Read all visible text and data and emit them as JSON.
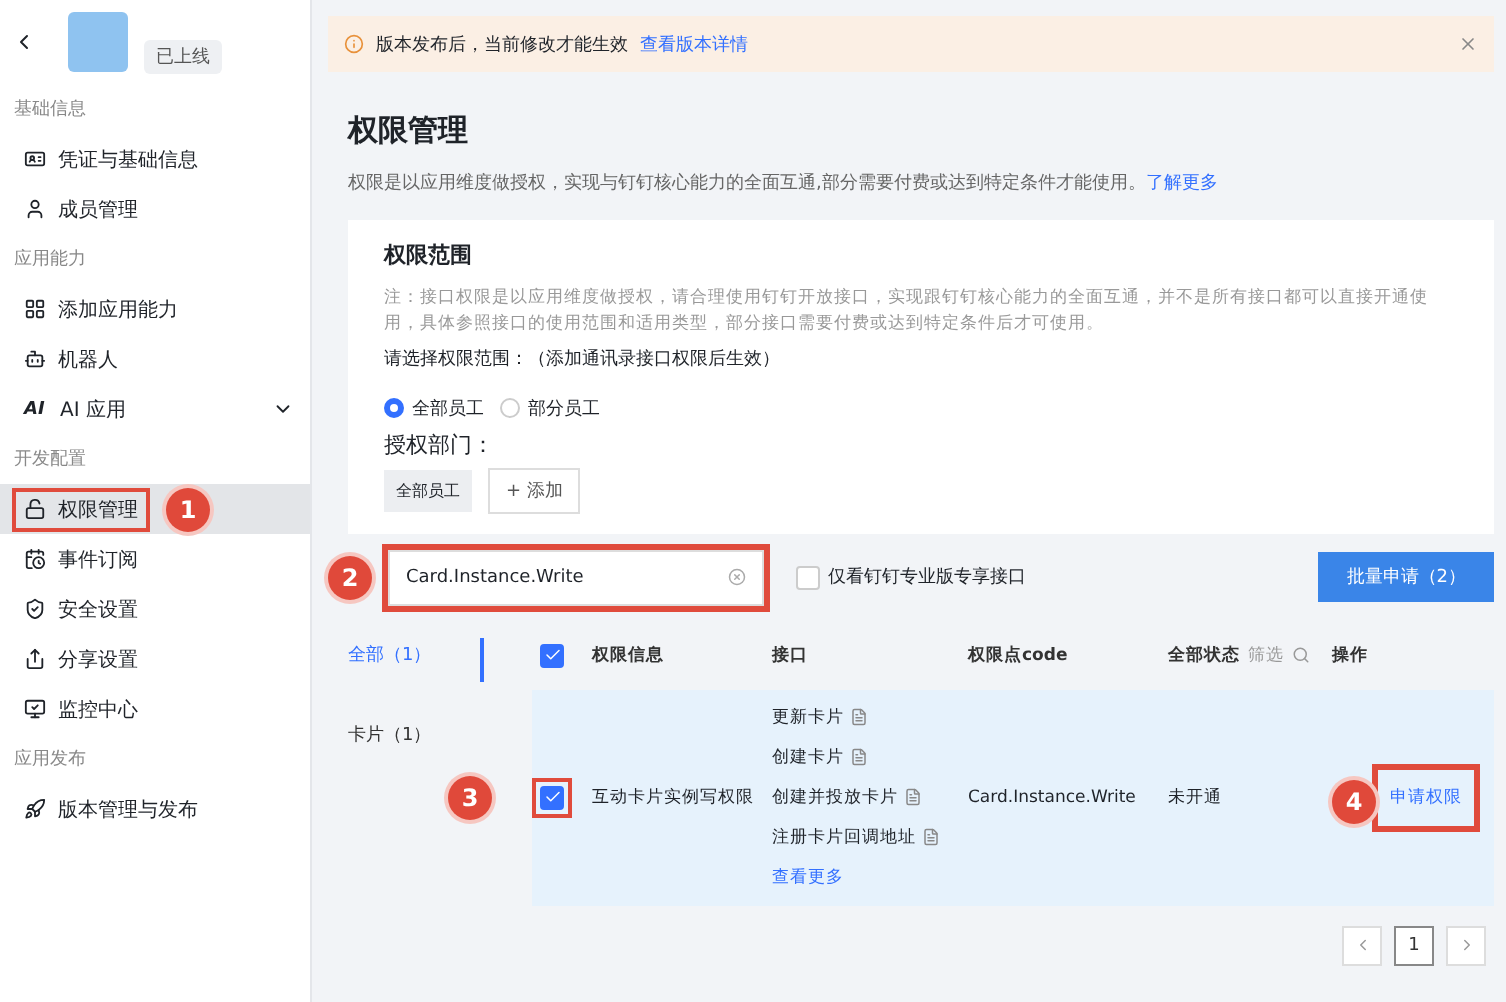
{
  "app": {
    "status": "已上线"
  },
  "sidebar": {
    "sections": [
      {
        "label": "基础信息",
        "items": [
          {
            "label": "凭证与基础信息",
            "selected": false
          },
          {
            "label": "成员管理",
            "selected": false
          }
        ]
      },
      {
        "label": "应用能力",
        "items": [
          {
            "label": "添加应用能力",
            "selected": false
          },
          {
            "label": "机器人",
            "selected": false
          },
          {
            "label": "AI 应用",
            "icon_label": "AI",
            "expanded": false,
            "selected": false
          }
        ]
      },
      {
        "label": "开发配置",
        "items": [
          {
            "label": "权限管理",
            "selected": true,
            "highlighted": true,
            "annotation": "1"
          },
          {
            "label": "事件订阅",
            "selected": false
          },
          {
            "label": "安全设置",
            "selected": false
          },
          {
            "label": "分享设置",
            "selected": false
          },
          {
            "label": "监控中心",
            "selected": false
          }
        ]
      },
      {
        "label": "应用发布",
        "items": [
          {
            "label": "版本管理与发布",
            "selected": false
          }
        ]
      }
    ]
  },
  "banner": {
    "text": "版本发布后，当前修改才能生效",
    "link": "查看版本详情"
  },
  "page": {
    "title": "权限管理",
    "description": "权限是以应用维度做授权，实现与钉钉核心能力的全面互通,部分需要付费或达到特定条件才能使用。",
    "link": "了解更多"
  },
  "scope": {
    "title": "权限范围",
    "note": "注：接口权限是以应用维度做授权，请合理使用钉钉开放接口，实现跟钉钉核心能力的全面互通，并不是所有接口都可以直接开通使用，具体参照接口的使用范围和适用类型，部分接口需要付费或达到特定条件后才可使用。",
    "prompt": "请选择权限范围：（添加通讯录接口权限后生效）",
    "options": [
      {
        "label": "全部员工",
        "selected": true
      },
      {
        "label": "部分员工",
        "selected": false
      }
    ],
    "dept_label": "授权部门：",
    "dept_tag": "全部员工",
    "add_button": "+ 添加"
  },
  "filter": {
    "annotation": "2",
    "search_value": "Card.Instance.Write",
    "highlighted": true,
    "pro_only": {
      "label": "仅看钉钉专业版专享接口",
      "checked": false
    },
    "batch_button": "批量申请（2）"
  },
  "categories": [
    {
      "label": "全部（1）",
      "selected": true
    },
    {
      "label": "卡片（1）",
      "selected": false
    }
  ],
  "table": {
    "all_checked": true,
    "columns": [
      "权限信息",
      "接口",
      "权限点code",
      "全部状态",
      "操作"
    ],
    "filter_label": "筛选",
    "rows": [
      {
        "checked": true,
        "annotation": "3",
        "highlighted": true,
        "name": "互动卡片实例写权限",
        "apis": [
          "更新卡片",
          "创建卡片",
          "创建并投放卡片",
          "注册卡片回调地址"
        ],
        "more": "查看更多",
        "code": "Card.Instance.Write",
        "status": "未开通",
        "action": "申请权限",
        "action_annotation": "4"
      }
    ]
  },
  "pagination": {
    "pages": [
      {
        "label": "1",
        "selected": true
      }
    ]
  }
}
